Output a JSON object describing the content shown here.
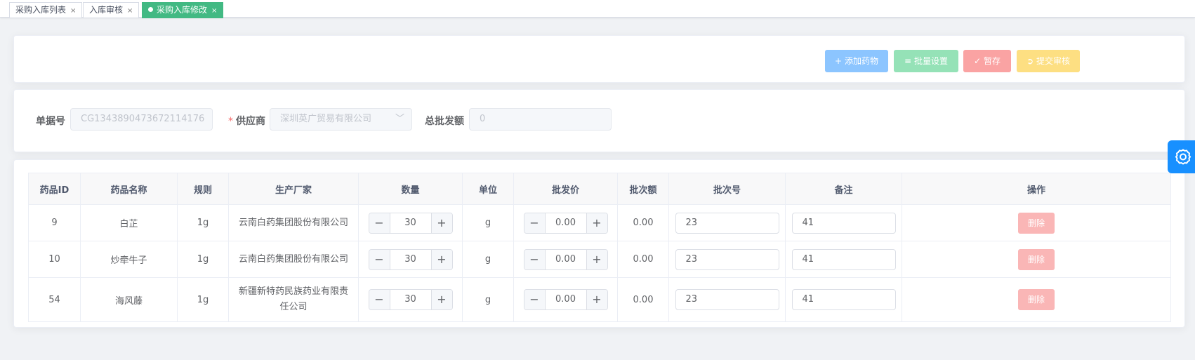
{
  "tabs": [
    {
      "label": "采购入库列表",
      "close": "×",
      "active": false
    },
    {
      "label": "入库审核",
      "close": "×",
      "active": false
    },
    {
      "label": "采购入库修改",
      "close": "×",
      "active": true
    }
  ],
  "toolbar": {
    "add_label": "添加药物",
    "batch_label": "批量设置",
    "save_label": "暂存",
    "submit_label": "提交审核",
    "colors": {
      "add": "#8cc5ff",
      "batch": "#95e2b7",
      "save": "#faa3a3",
      "submit": "#fddf82"
    }
  },
  "form": {
    "order_no_label": "单据号",
    "order_no_value": "CG1343890473672114176",
    "supplier_required_mark": "*",
    "supplier_label": "供应商",
    "supplier_value": "深圳英广贸易有限公司",
    "total_label": "总批发额",
    "total_value": "0"
  },
  "table": {
    "headers": [
      "药品ID",
      "药品名称",
      "规则",
      "生产厂家",
      "数量",
      "单位",
      "批发价",
      "批次额",
      "批次号",
      "备注",
      "操作"
    ],
    "rows": [
      {
        "id": "9",
        "name": "白芷",
        "spec": "1g",
        "manufacturer": "云南白药集团股份有限公司",
        "qty": "30",
        "unit": "g",
        "price": "0.00",
        "amount": "0.00",
        "batch": "23",
        "remark": "41",
        "action": "删除"
      },
      {
        "id": "10",
        "name": "炒牵牛子",
        "spec": "1g",
        "manufacturer": "云南白药集团股份有限公司",
        "qty": "30",
        "unit": "g",
        "price": "0.00",
        "amount": "0.00",
        "batch": "23",
        "remark": "41",
        "action": "删除"
      },
      {
        "id": "54",
        "name": "海风藤",
        "spec": "1g",
        "manufacturer": "新疆新特药民族药业有限责任公司",
        "qty": "30",
        "unit": "g",
        "price": "0.00",
        "amount": "0.00",
        "batch": "23",
        "remark": "41",
        "action": "删除"
      }
    ],
    "stepper_minus": "−",
    "stepper_plus": "+"
  },
  "icons": {
    "add": "plus-icon",
    "batch": "sliders-icon",
    "save": "check-icon",
    "submit": "submit-icon",
    "settings": "gear-icon",
    "select": "chevron-down-icon"
  }
}
